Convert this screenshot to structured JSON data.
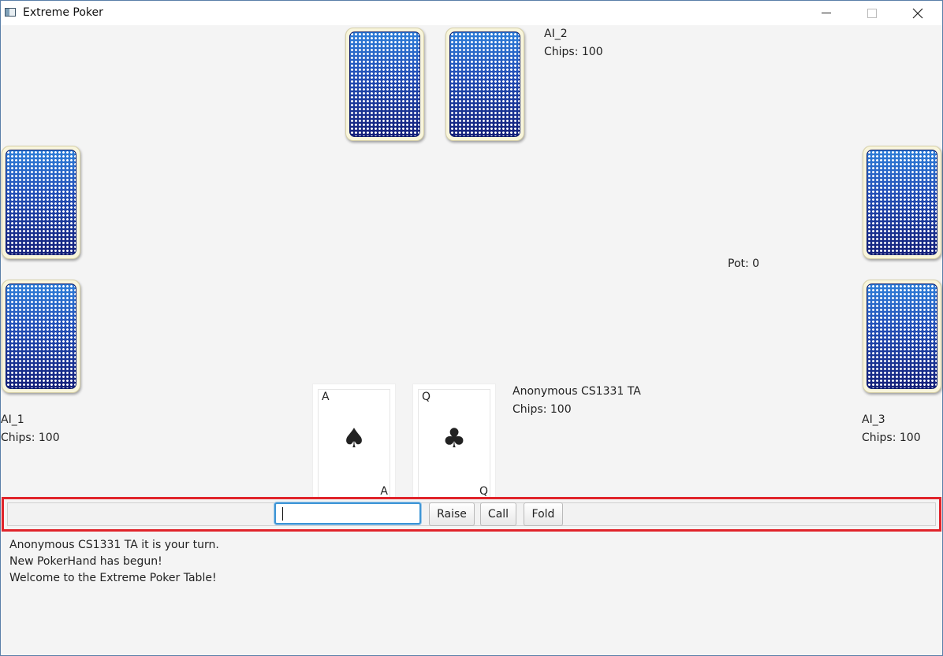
{
  "window": {
    "title": "Extreme Poker",
    "icon": "app-window-icon"
  },
  "players": {
    "ai_1": {
      "name": "AI_1",
      "chips": "Chips: 100"
    },
    "ai_2": {
      "name": "AI_2",
      "chips": "Chips: 100"
    },
    "ai_3": {
      "name": "AI_3",
      "chips": "Chips: 100"
    },
    "human": {
      "name": "Anonymous CS1331 TA",
      "chips": "Chips: 100",
      "cards": [
        {
          "rank": "A",
          "suit": "♠",
          "suit_name": "spade"
        },
        {
          "rank": "Q",
          "suit": "♣",
          "suit_name": "club"
        }
      ]
    }
  },
  "pot": "Pot: 0",
  "controls": {
    "bet_value": "",
    "raise_label": "Raise",
    "call_label": "Call",
    "fold_label": "Fold",
    "highlight_color": "#e0242b"
  },
  "log": [
    "Anonymous CS1331 TA it is your turn.",
    "New PokerHand has begun!",
    "Welcome to the Extreme Poker Table!"
  ],
  "colors": {
    "card_back_blue": "#2350b8",
    "background": "#f4f4f4",
    "input_focus": "#3d95d6"
  }
}
